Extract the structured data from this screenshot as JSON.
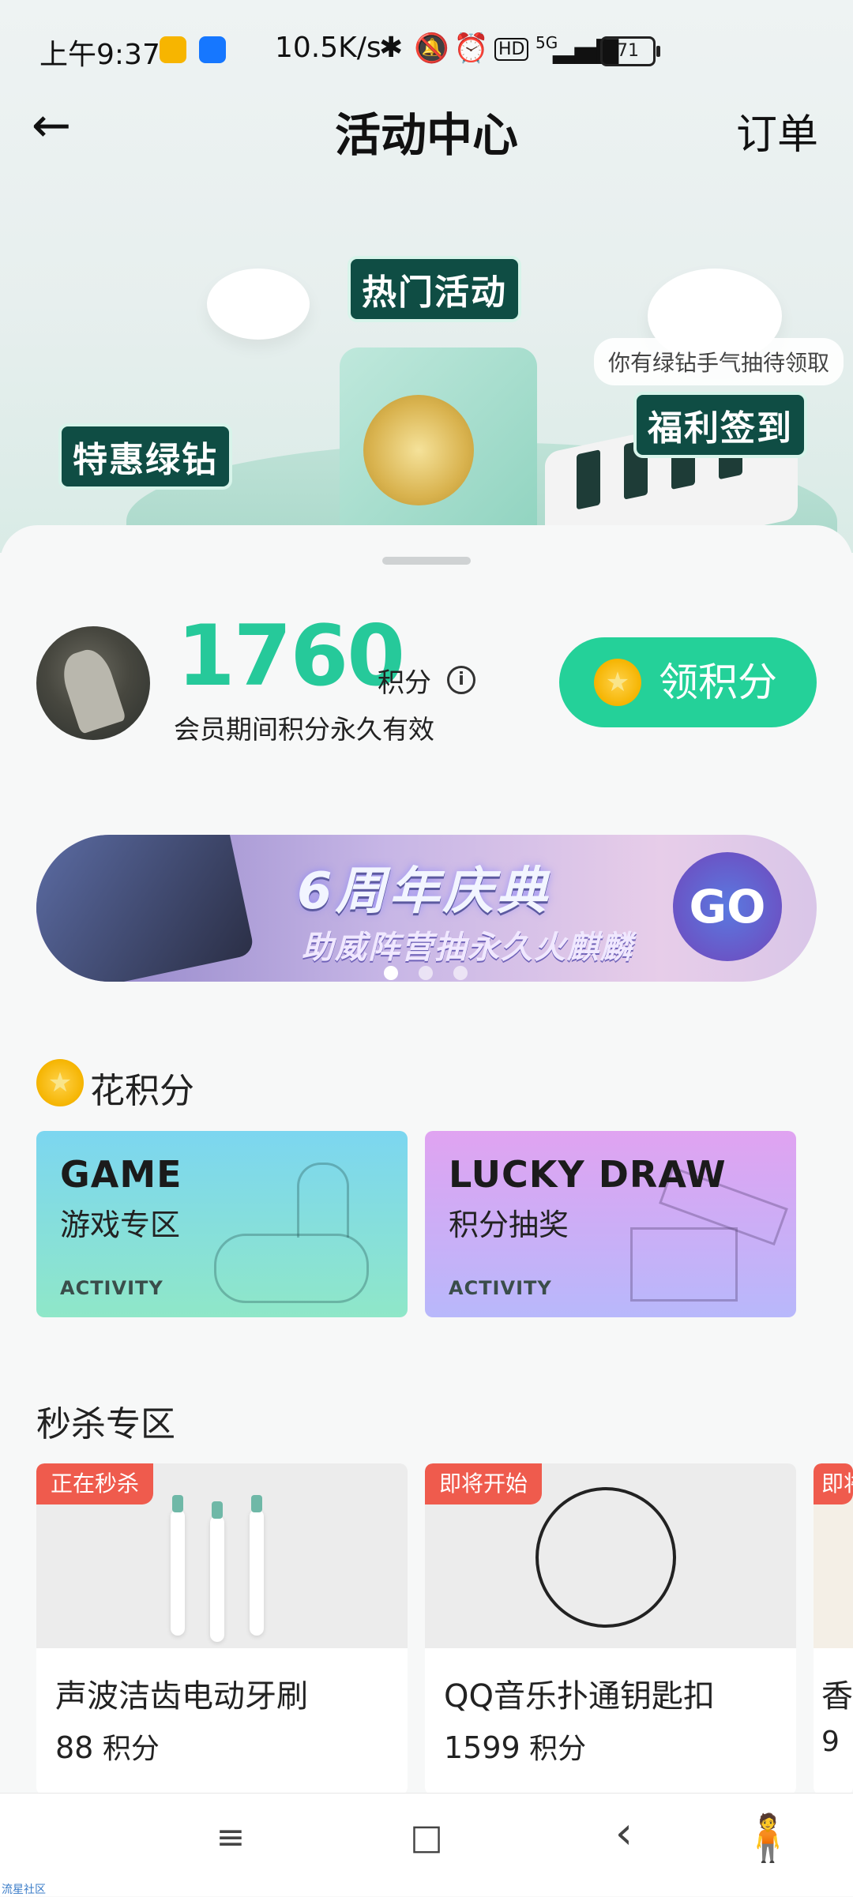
{
  "status_bar": {
    "time": "上午9:37",
    "net_speed": "10.5K/s",
    "network": "5G",
    "battery": "71"
  },
  "nav": {
    "title": "活动中心",
    "orders": "订单"
  },
  "hero": {
    "label_hot": "热门活动",
    "label_diamond": "特惠绿钻",
    "label_signin": "福利签到",
    "tip": "你有绿钻手气抽待领取"
  },
  "points": {
    "value": "1760",
    "unit": "积分",
    "note": "会员期间积分永久有效",
    "earn_button": "领积分"
  },
  "banner": {
    "title": "6周年庆典",
    "subtitle": "助威阵营抽永久火麒麟",
    "go": "GO",
    "dots_count": 3,
    "active_dot": 1
  },
  "spend": {
    "section_title": "花积分",
    "cards": [
      {
        "en": "GAME",
        "cn": "游戏专区",
        "tag": "ACTIVITY"
      },
      {
        "en": "LUCKY DRAW",
        "cn": "积分抽奖",
        "tag": "ACTIVITY"
      }
    ]
  },
  "flash_sale": {
    "section_title": "秒杀专区",
    "items": [
      {
        "tag": "正在秒杀",
        "name": "声波洁齿电动牙刷",
        "price": "88",
        "unit": "积分"
      },
      {
        "tag": "即将开始",
        "name": "QQ音乐扑通钥匙扣",
        "price": "1599",
        "unit": "积分"
      },
      {
        "tag": "即将",
        "name": "香",
        "price": "9",
        "unit": ""
      }
    ]
  },
  "system_nav": {
    "menu_glyph": "≡",
    "home_glyph": "□",
    "back_glyph": "‹"
  },
  "corner_text": "流星社区",
  "colors": {
    "accent_green": "#24d199",
    "points_green": "#26c99a",
    "flash_tag_red": "#ef5b4d"
  }
}
